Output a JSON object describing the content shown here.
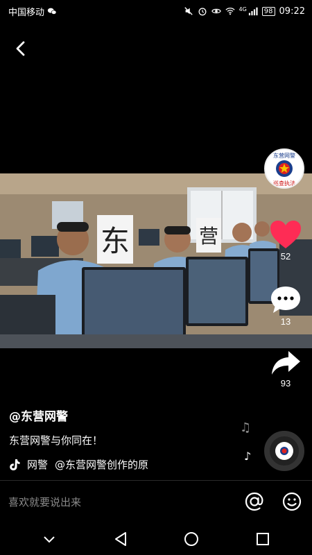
{
  "status_bar": {
    "carrier": "中国移动",
    "network": "4G",
    "battery": "98",
    "time": "09:22"
  },
  "video": {
    "signs": [
      "东",
      "营"
    ]
  },
  "rail": {
    "avatar_text_top": "东营网警",
    "avatar_text_bottom": "巡查执法",
    "like_count": "52",
    "comment_count": "13",
    "share_count": "93"
  },
  "caption": {
    "author": "@东营网警",
    "description": "东营网警与你同在！",
    "tag": "网警",
    "music": "@东营网警创作的原"
  },
  "comment_bar": {
    "placeholder": "喜欢就要说出来"
  },
  "colors": {
    "like": "#fe2c55",
    "background": "#000000",
    "placeholder": "#8a8a8a"
  },
  "icons": [
    "back-icon",
    "heart-icon",
    "comment-icon",
    "share-icon",
    "at-icon",
    "emoji-icon",
    "music-note-icon",
    "nav-back-icon",
    "nav-home-icon",
    "nav-recent-icon",
    "nav-down-icon"
  ]
}
